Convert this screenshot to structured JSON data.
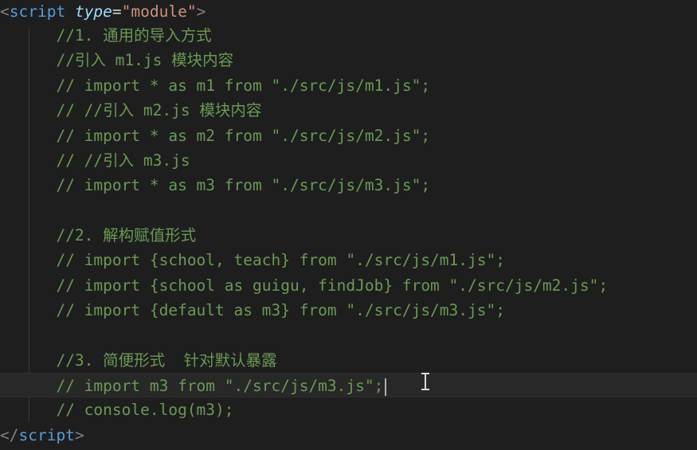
{
  "editor": {
    "colors": {
      "background": "#1e1e1e",
      "current_line": "#282828",
      "tag": "#569cd6",
      "bracket": "#808080",
      "attribute": "#9cdcfe",
      "string": "#ce9178",
      "comment": "#6a9955"
    },
    "open_tag": {
      "open_bracket": "<",
      "name": "script",
      "attr_name": "type",
      "equals": "=",
      "attr_value": "\"module\"",
      "close_bracket": ">"
    },
    "close_tag": {
      "open_bracket": "</",
      "name": "script",
      "close_bracket": ">"
    },
    "lines": [
      "//1. 通用的导入方式",
      "//引入 m1.js 模块内容",
      "// import * as m1 from \"./src/js/m1.js\";",
      "// //引入 m2.js 模块内容",
      "// import * as m2 from \"./src/js/m2.js\";",
      "// //引入 m3.js",
      "// import * as m3 from \"./src/js/m3.js\";",
      "",
      "//2. 解构赋值形式",
      "// import {school, teach} from \"./src/js/m1.js\";",
      "// import {school as guigu, findJob} from \"./src/js/m2.js\";",
      "// import {default as m3} from \"./src/js/m3.js\";",
      "",
      "//3. 简便形式  针对默认暴露",
      "// import m3 from \"./src/js/m3.js\";",
      "// console.log(m3);"
    ],
    "cursor_line_index": 14,
    "mouse_pointer": "text-cursor-icon"
  }
}
